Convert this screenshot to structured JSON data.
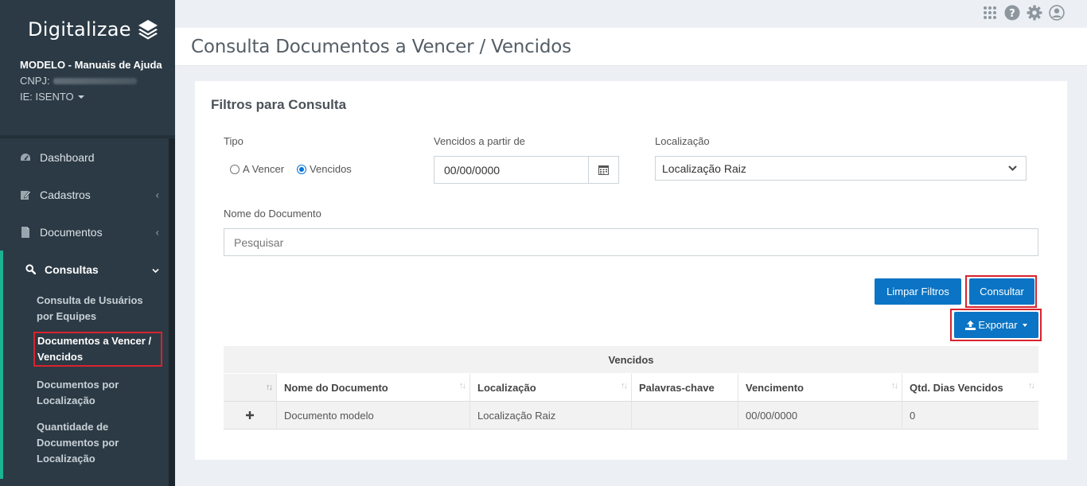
{
  "sidebar": {
    "brand": "Digitalizae",
    "company_name": "MODELO - Manuais de Ajuda",
    "cnpj_label": "CNPJ:",
    "ie_label": "IE: ISENTO",
    "menu": [
      {
        "label": "Dashboard",
        "icon": "dashboard-icon"
      },
      {
        "label": "Cadastros",
        "icon": "edit-icon"
      },
      {
        "label": "Documentos",
        "icon": "file-icon"
      },
      {
        "label": "Consultas",
        "icon": "search-icon"
      }
    ],
    "submenu": [
      "Consulta de Usuários por Equipes",
      "Documentos a Vencer / Vencidos",
      "Documentos por Localização",
      "Quantidade de Documentos por Localização"
    ]
  },
  "topbar": {
    "icons": [
      "apps-grid-icon",
      "help-icon",
      "gear-icon",
      "user-icon"
    ]
  },
  "page": {
    "title": "Consulta Documentos a Vencer / Vencidos"
  },
  "filters": {
    "title": "Filtros para Consulta",
    "tipo_label": "Tipo",
    "radio_a_vencer": "A Vencer",
    "radio_vencidos": "Vencidos",
    "radio_selected": "Vencidos",
    "vencidos_label": "Vencidos a partir de",
    "date_value": "00/00/0000",
    "localizacao_label": "Localização",
    "localizacao_value": "Localização Raiz",
    "nome_label": "Nome do Documento",
    "search_placeholder": "Pesquisar",
    "btn_limpar": "Limpar Filtros",
    "btn_consultar": "Consultar",
    "btn_exportar": "Exportar"
  },
  "table": {
    "group_title": "Vencidos",
    "columns": [
      "Nome do Documento",
      "Localização",
      "Palavras-chave",
      "Vencimento",
      "Qtd. Dias Vencidos"
    ],
    "rows": [
      [
        "Documento modelo",
        "Localização Raiz",
        "",
        "00/00/0000",
        "0"
      ]
    ]
  },
  "colors": {
    "sidebar_bg": "#2b3a45",
    "accent_green": "#1bb394",
    "primary_blue": "#0b74c4",
    "highlight_red": "#d9232d"
  }
}
